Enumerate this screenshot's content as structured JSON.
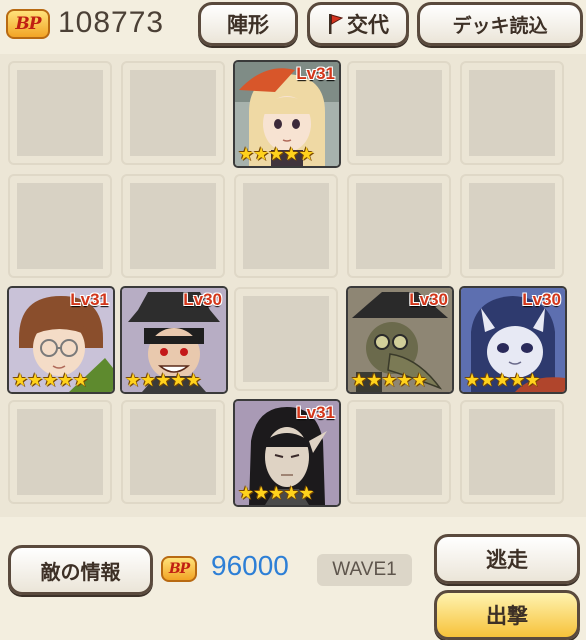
{
  "top": {
    "bp_icon_text": "BP",
    "bp_total": "108773",
    "formation_label": "陣形",
    "swap_label": "交代",
    "deck_load_label": "デッキ読込"
  },
  "grid": {
    "units": [
      {
        "id": "unit-1",
        "level": "Lv31",
        "stars": "★★★★★",
        "portrait": "girl-blonde-orange-beret"
      },
      {
        "id": "unit-2",
        "level": "Lv31",
        "stars": "★★★★★",
        "portrait": "man-brown-hair-glasses"
      },
      {
        "id": "unit-3",
        "level": "Lv30",
        "stars": "★★★★★",
        "portrait": "boy-black-hat-grin"
      },
      {
        "id": "unit-4",
        "level": "Lv30",
        "stars": "★★★★★",
        "portrait": "plague-doctor-mask"
      },
      {
        "id": "unit-5",
        "level": "Lv30",
        "stars": "★★★★★",
        "portrait": "blue-hooded-creature"
      },
      {
        "id": "unit-6",
        "level": "Lv31",
        "stars": "★★★★★",
        "portrait": "long-black-hair-elf"
      }
    ]
  },
  "bottom": {
    "enemy_info_label": "敵の情報",
    "bp_icon_text": "BP",
    "enemy_bp": "96000",
    "wave_label": "WAVE1",
    "escape_label": "逃走",
    "sortie_label": "出撃"
  },
  "colors": {
    "background": "#f3eedf",
    "bp_value": "#4b4036",
    "enemy_bp": "#2d7fd6",
    "level_text": "#d2361a",
    "sortie_button": "#f6c23a"
  }
}
